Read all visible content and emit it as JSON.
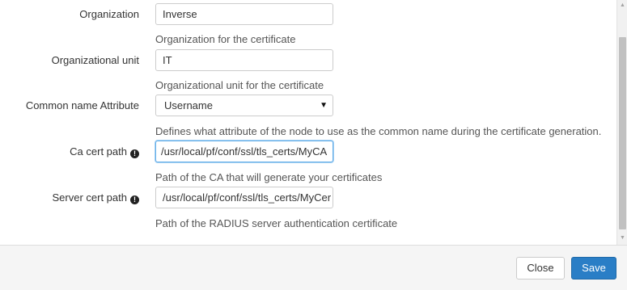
{
  "form": {
    "organization": {
      "label": "Organization",
      "value": "Inverse",
      "help": "Organization for the certificate"
    },
    "organizational_unit": {
      "label": "Organizational unit",
      "value": "IT",
      "help": "Organizational unit for the certificate"
    },
    "common_name_attribute": {
      "label": "Common name Attribute",
      "selected": "Username",
      "help": "Defines what attribute of the node to use as the common name during the certificate generation."
    },
    "ca_cert_path": {
      "label": "Ca cert path",
      "value": "/usr/local/pf/conf/ssl/tls_certs/MyCA",
      "help": "Path of the CA that will generate your certificates",
      "icon": "exclamation-circle-icon"
    },
    "server_cert_path": {
      "label": "Server cert path",
      "value": "/usr/local/pf/conf/ssl/tls_certs/MyCer",
      "help": "Path of the RADIUS server authentication certificate",
      "icon": "exclamation-circle-icon"
    }
  },
  "footer": {
    "close_label": "Close",
    "save_label": "Save"
  },
  "colors": {
    "primary": "#2a7ec6",
    "focus_border": "#66afe9"
  }
}
